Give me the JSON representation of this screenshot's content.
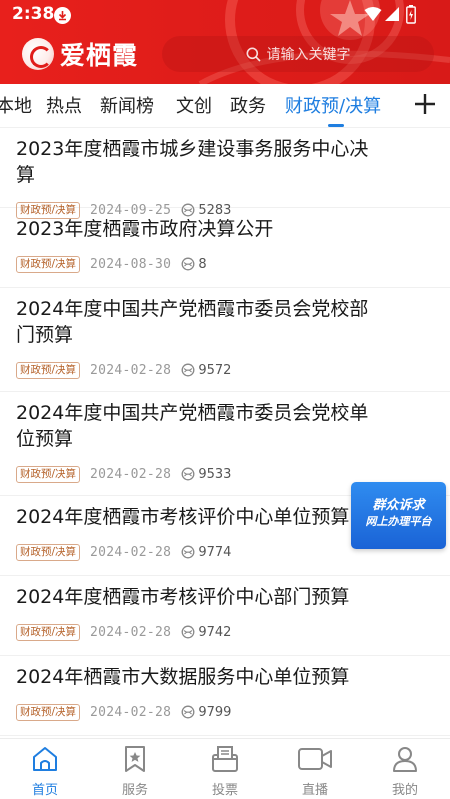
{
  "status_bar": {
    "time": "2:38"
  },
  "header": {
    "logo_text": "爱栖霞",
    "search_placeholder": "请输入关键字"
  },
  "tabs": [
    {
      "label": "本地",
      "active": false
    },
    {
      "label": "热点",
      "active": false
    },
    {
      "label": "新闻榜",
      "active": false
    },
    {
      "label": "文创",
      "active": false
    },
    {
      "label": "政务",
      "active": false
    },
    {
      "label": "财政预/决算",
      "active": true
    }
  ],
  "articles": [
    {
      "title": "2023年度栖霞市城乡建设事务服务中心决算",
      "tag": "财政预/决算",
      "date": "2024-09-25",
      "views": "5283"
    },
    {
      "title": "2023年度栖霞市政府决算公开",
      "tag": "财政预/决算",
      "date": "2024-08-30",
      "views": "8"
    },
    {
      "title": "2024年度中国共产党栖霞市委员会党校部门预算",
      "tag": "财政预/决算",
      "date": "2024-02-28",
      "views": "9572"
    },
    {
      "title": "2024年度中国共产党栖霞市委员会党校单位预算",
      "tag": "财政预/决算",
      "date": "2024-02-28",
      "views": "9533"
    },
    {
      "title": "2024年度栖霞市考核评价中心单位预算",
      "tag": "财政预/决算",
      "date": "2024-02-28",
      "views": "9774"
    },
    {
      "title": "2024年度栖霞市考核评价中心部门预算",
      "tag": "财政预/决算",
      "date": "2024-02-28",
      "views": "9742"
    },
    {
      "title": "2024年栖霞市大数据服务中心单位预算",
      "tag": "财政预/决算",
      "date": "2024-02-28",
      "views": "9799"
    }
  ],
  "float_badge": {
    "line1": "群众诉求",
    "line2": "网上办理平台"
  },
  "bottom_nav": [
    {
      "label": "首页",
      "icon": "home-icon",
      "active": true
    },
    {
      "label": "服务",
      "icon": "bookmark-star-icon",
      "active": false
    },
    {
      "label": "投票",
      "icon": "ballot-box-icon",
      "active": false
    },
    {
      "label": "直播",
      "icon": "video-camera-icon",
      "active": false
    },
    {
      "label": "我的",
      "icon": "user-icon",
      "active": false
    }
  ],
  "colors": {
    "header_red": "#e01d1a",
    "accent_blue": "#1f7ee0",
    "tag_orange": "#b5622a"
  }
}
